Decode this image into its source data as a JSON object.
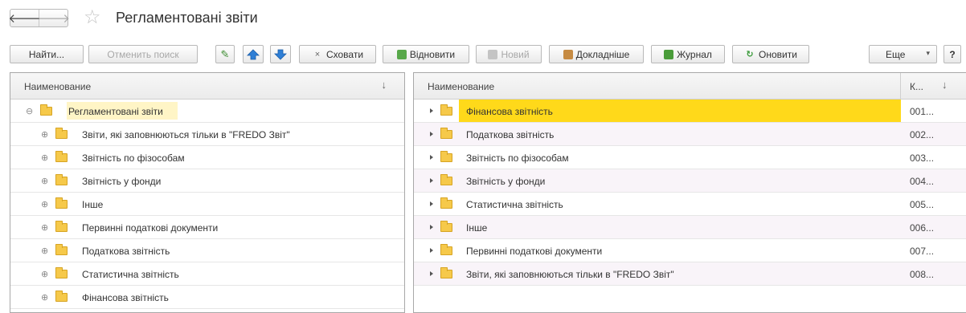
{
  "window": {
    "title": "Регламентовані звіти"
  },
  "icons": {
    "back": "arrow-left-icon",
    "forward": "arrow-right-icon",
    "favorite": "star-icon"
  },
  "nav": {
    "back": "🡐",
    "forward": "🡒",
    "star": "☆"
  },
  "toolbar": {
    "find": "Найти...",
    "cancel_search": "Отменить поиск",
    "hide": "Сховати",
    "restore": "Відновити",
    "new": "Новий",
    "details": "Докладніше",
    "journal": "Журнал",
    "refresh": "Оновити",
    "more": "Еще",
    "help": "?",
    "pencil_glyph": "✎",
    "close_glyph": "×",
    "refresh_glyph": "↻",
    "more_arrow": "▾"
  },
  "left_panel": {
    "header": "Наименование",
    "sort_glyph": "↓",
    "root": {
      "label": "Регламентовані звіти",
      "toggle": "⊖"
    },
    "items": [
      {
        "label": "Звіти, які заповнюються тільки в \"FREDO Звіт\"",
        "toggle": "⊕"
      },
      {
        "label": "Звітність по фізособам",
        "toggle": "⊕"
      },
      {
        "label": "Звітність у фонди",
        "toggle": "⊕"
      },
      {
        "label": "Інше",
        "toggle": "⊕"
      },
      {
        "label": "Первинні податкові документи",
        "toggle": "⊕"
      },
      {
        "label": "Податкова звітність",
        "toggle": "⊕"
      },
      {
        "label": "Статистична звітність",
        "toggle": "⊕"
      },
      {
        "label": "Фінансова звітність",
        "toggle": "⊕"
      }
    ]
  },
  "right_panel": {
    "header_name": "Наименование",
    "header_code": "К...",
    "sort_glyph": "↓",
    "rows": [
      {
        "name": "Фінансова звітність",
        "code": "001..."
      },
      {
        "name": "Податкова звітність",
        "code": "002..."
      },
      {
        "name": "Звітність по фізособам",
        "code": "003..."
      },
      {
        "name": "Звітність у фонди",
        "code": "004..."
      },
      {
        "name": "Статистична звітність",
        "code": "005..."
      },
      {
        "name": "Інше",
        "code": "006..."
      },
      {
        "name": "Первинні податкові документи",
        "code": "007..."
      },
      {
        "name": "Звіти, які заповнюються тільки в \"FREDO Звіт\"",
        "code": "008..."
      }
    ]
  },
  "colors": {
    "selection": "#ffd91a",
    "root_highlight": "#fff5c6",
    "folder": "#f6c94a"
  }
}
